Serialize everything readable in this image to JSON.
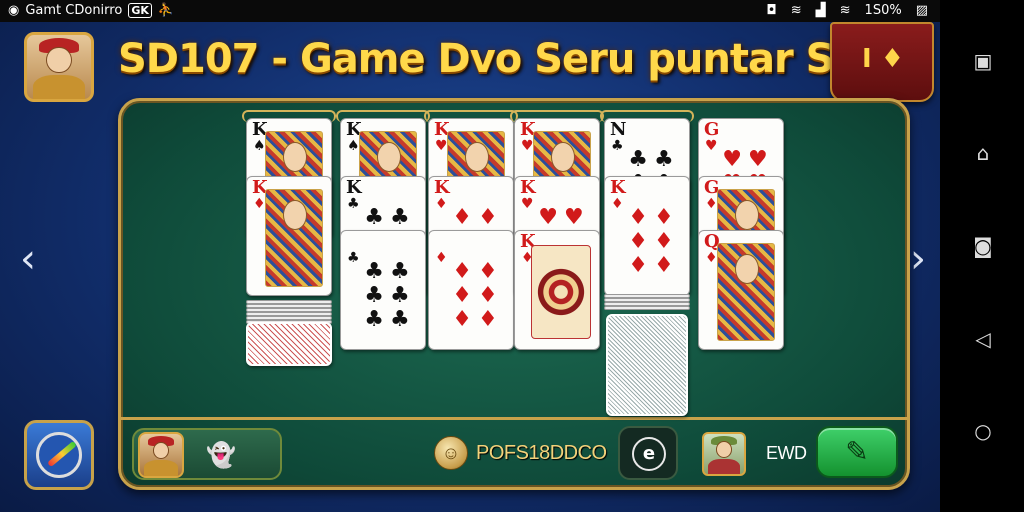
{
  "status_bar": {
    "app_name": "Gamt CDonirro",
    "box_label": "GK",
    "battery_text": "1S0%"
  },
  "header": {
    "title": "SD107 - Game Dvo Seru puntar Sema",
    "menu_glyph": "I ♦"
  },
  "navigation": {
    "left_arrow": "‹",
    "right_arrow": "›"
  },
  "bottom_bar": {
    "score_text": "POFS18DDCO",
    "timer_symbol": "e",
    "end_label": "EWD",
    "play_symbol": "✎"
  },
  "android_nav": {
    "recents": "▣",
    "home": "⌂",
    "screenshot": "◙",
    "back": "◁",
    "assist": "○"
  },
  "tableau": [
    {
      "cards": [
        {
          "rank": "K",
          "suit": "♠",
          "color": "black",
          "type": "face"
        },
        {
          "rank": "K",
          "suit": "♦",
          "color": "red",
          "type": "face"
        }
      ]
    },
    {
      "cards": [
        {
          "rank": "K",
          "suit": "♠",
          "color": "black",
          "type": "face"
        },
        {
          "rank": "K",
          "suit": "♣",
          "color": "black",
          "type": "pips"
        },
        {
          "rank": "",
          "suit": "♣",
          "color": "black",
          "type": "pips"
        }
      ]
    },
    {
      "cards": [
        {
          "rank": "K",
          "suit": "♥",
          "color": "red",
          "type": "face"
        },
        {
          "rank": "K",
          "suit": "♦",
          "color": "red",
          "type": "pips"
        },
        {
          "rank": "",
          "suit": "♦",
          "color": "red",
          "type": "pips"
        }
      ]
    },
    {
      "cards": [
        {
          "rank": "K",
          "suit": "♥",
          "color": "red",
          "type": "face"
        },
        {
          "rank": "K",
          "suit": "♥",
          "color": "red",
          "type": "pips"
        },
        {
          "rank": "K",
          "suit": "♦",
          "color": "red",
          "type": "mandala"
        }
      ]
    },
    {
      "cards": [
        {
          "rank": "N",
          "suit": "♣",
          "color": "black",
          "type": "pips"
        },
        {
          "rank": "K",
          "suit": "♦",
          "color": "red",
          "type": "pips"
        }
      ]
    },
    {
      "cards": [
        {
          "rank": "G",
          "suit": "♥",
          "color": "red",
          "type": "pips"
        },
        {
          "rank": "G",
          "suit": "♦",
          "color": "red",
          "type": "face"
        },
        {
          "rank": "Q",
          "suit": "♦",
          "color": "red",
          "type": "face"
        }
      ]
    }
  ],
  "colors": {
    "felt": "#0f4b3a",
    "gold_trim": "#c8a24b",
    "title_yellow": "#ffd84a",
    "play_green": "#14922f"
  }
}
